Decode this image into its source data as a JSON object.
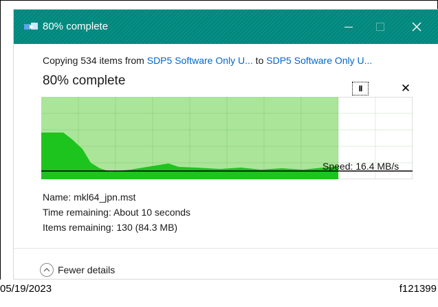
{
  "window": {
    "title": "80% complete",
    "minimize_icon": "minimize-icon",
    "maximize_icon": "maximize-icon",
    "close_glyph": "✕"
  },
  "copy": {
    "prefix": "Copying 534 items from ",
    "source": "SDP5 Software Only U...",
    "middle": " to ",
    "destination": "SDP5 Software Only U...",
    "link_color": "#0066cc"
  },
  "status": "80% complete",
  "controls": {
    "pause_glyph": "II",
    "cancel_glyph": "✕"
  },
  "progress": {
    "fraction": 0.8,
    "fill_color": "#abe59a",
    "speed_area_color": "#1dc41d",
    "speed_label": "Speed: 16.4 MB/s"
  },
  "details": {
    "name_label": "Name: ",
    "name_value": "mkl64_jpn.mst",
    "time_label": "Time remaining: ",
    "time_value": "About 10 seconds",
    "items_label": "Items remaining: ",
    "items_value": "130 (84.3 MB)"
  },
  "fewer_details": "Fewer details",
  "footer": {
    "date": "05/19/2023",
    "figure_id": "f121399"
  },
  "colors": {
    "titlebar": "#008a80",
    "accent_link": "#0066cc"
  }
}
